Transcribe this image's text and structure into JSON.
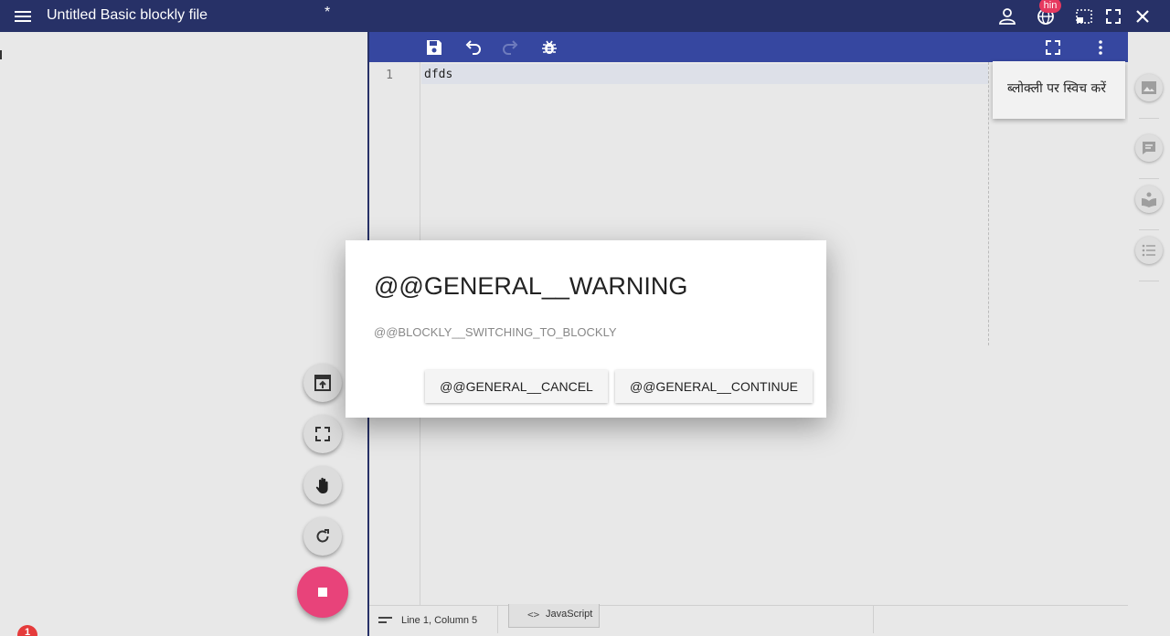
{
  "appbar": {
    "title": "Untitled Basic blockly file",
    "dirty_marker": "*",
    "lang_badge": "hin"
  },
  "editor": {
    "line_number": "1",
    "code": "dfds",
    "popup_label": "ब्लोक्ली पर स्विच करें"
  },
  "statusbar": {
    "cursor_position": "Line 1, Column 5",
    "language": "JavaScript"
  },
  "errors": {
    "count": "1"
  },
  "dialog": {
    "title": "@@GENERAL__WARNING",
    "message": "@@BLOCKLY__SWITCHING_TO_BLOCKLY",
    "cancel_label": "@@GENERAL__CANCEL",
    "continue_label": "@@GENERAL__CONTINUE"
  },
  "colors": {
    "appbar": "#273167",
    "toolbar": "#3647a0",
    "fab": "#e8437a",
    "badge": "#e6395f"
  }
}
